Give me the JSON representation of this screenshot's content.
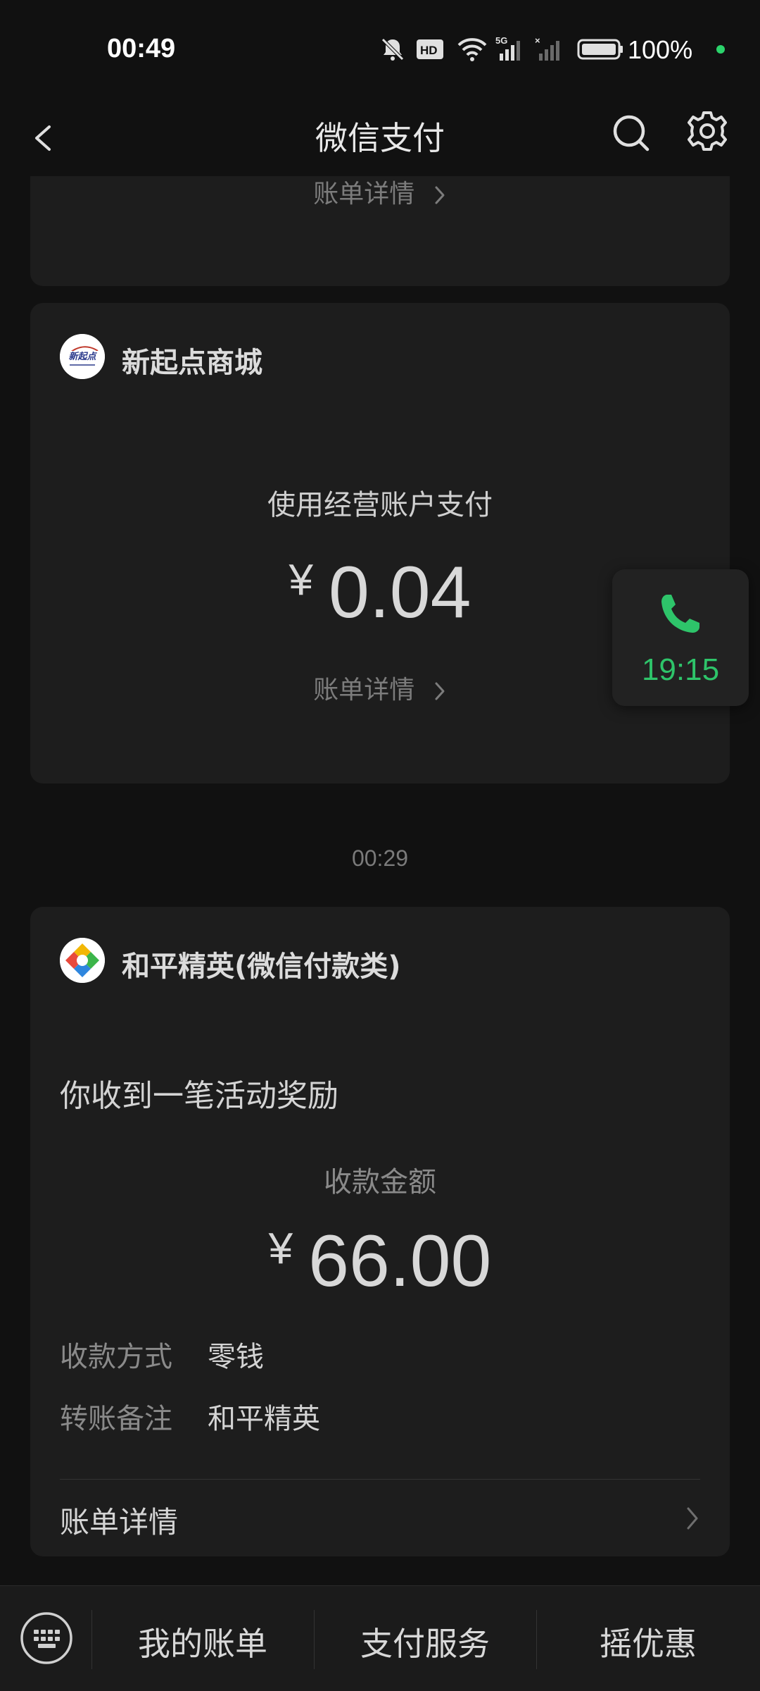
{
  "status_bar": {
    "time": "00:49",
    "battery": "100%",
    "icons": [
      "mute-icon",
      "hd-icon",
      "wifi-icon",
      "signal-5g-icon",
      "signal-no-service-icon",
      "battery-icon"
    ],
    "dot_color": "#2bd36b"
  },
  "header": {
    "title": "微信支付",
    "back_icon": "chevron-left-icon",
    "search_icon": "search-icon",
    "settings_icon": "gear-icon"
  },
  "cards": [
    {
      "bill_link": "账单详情"
    },
    {
      "merchant": "新起点商城",
      "logo_text": "新起点",
      "description": "使用经营账户支付",
      "currency": "¥",
      "amount": "0.04",
      "bill_link": "账单详情"
    }
  ],
  "timestamp": "00:29",
  "reward_card": {
    "merchant": "和平精英(微信付款类)",
    "message": "你收到一笔活动奖励",
    "amount_label": "收款金额",
    "currency": "¥",
    "amount": "66.00",
    "fields": [
      {
        "key": "收款方式",
        "value": "零钱"
      },
      {
        "key": "转账备注",
        "value": "和平精英"
      }
    ],
    "bill_link": "账单详情"
  },
  "call_bubble": {
    "time": "19:15",
    "icon": "phone-icon",
    "color": "#2ec46a"
  },
  "bottom_menu": {
    "keyboard_icon": "keyboard-icon",
    "items": [
      "我的账单",
      "支付服务",
      "摇优惠"
    ]
  }
}
